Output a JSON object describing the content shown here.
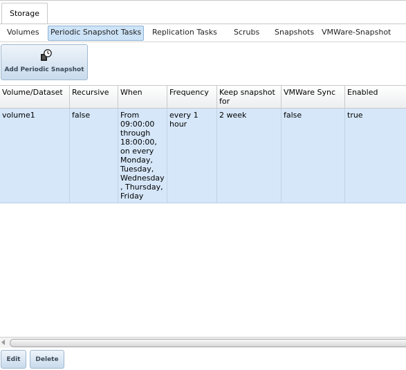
{
  "top_tabs": {
    "storage": "Storage"
  },
  "subnav": {
    "volumes": "Volumes",
    "periodic_snapshot_tasks": "Periodic Snapshot Tasks",
    "replication_tasks": "Replication Tasks",
    "scrubs": "Scrubs",
    "snapshots": "Snapshots",
    "vmware_snapshot": "VMWare-Snapshot"
  },
  "toolbar": {
    "add_label": "Add Periodic Snapshot",
    "add_icon": "clock-snapshot-icon"
  },
  "table": {
    "columns": [
      "Volume/Dataset",
      "Recursive",
      "When",
      "Frequency",
      "Keep snapshot for",
      "VMWare Sync",
      "Enabled"
    ],
    "rows": [
      {
        "volume": "volume1",
        "recursive": "false",
        "when": "From 09:00:00 through 18:00:00, on every Monday, Tuesday, Wednesday, Thursday, Friday",
        "frequency": "every 1 hour",
        "keep": "2 week",
        "vmware_sync": "false",
        "enabled": "true"
      }
    ]
  },
  "footer": {
    "edit_label": "Edit",
    "delete_label": "Delete"
  },
  "colors": {
    "selected_row": "#d6e7f9",
    "active_tab": "#cde3f7",
    "button": "#c9dbec"
  }
}
